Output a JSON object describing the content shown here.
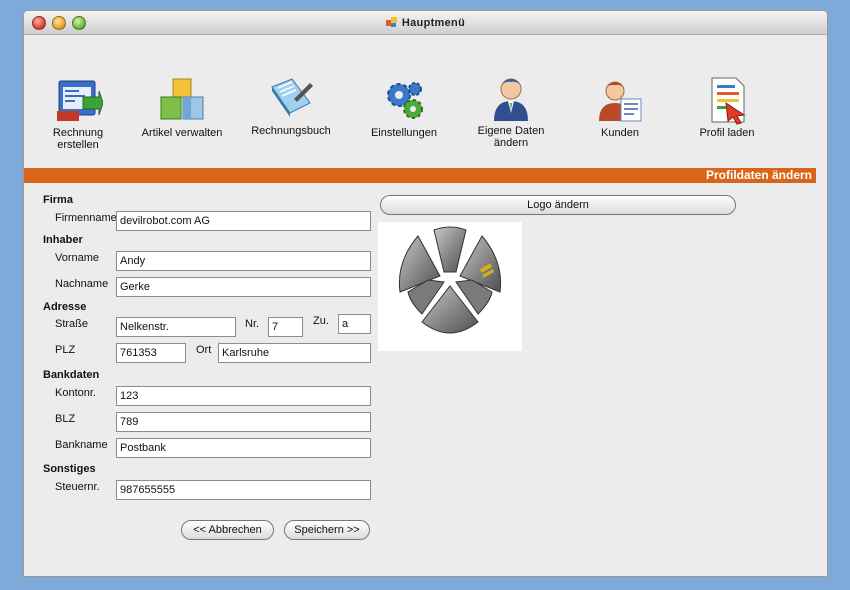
{
  "window": {
    "title": "Hauptmenü"
  },
  "toolbar": [
    {
      "label": "Rechnung\nerstellen",
      "icon": "invoice-create-icon"
    },
    {
      "label": "Artikel verwalten",
      "icon": "boxes-icon"
    },
    {
      "label": "Rechnungsbuch",
      "icon": "book-icon"
    },
    {
      "label": "Einstellungen",
      "icon": "gears-icon"
    },
    {
      "label": "Eigene Daten\nändern",
      "icon": "user-icon"
    },
    {
      "label": "Kunden",
      "icon": "customer-icon"
    },
    {
      "label": "Profil laden",
      "icon": "profile-document-icon"
    }
  ],
  "banner": {
    "title": "Profildaten ändern"
  },
  "colors": {
    "accent": "#d9651a",
    "background": "#7fa9d8",
    "window": "#ececec"
  },
  "form": {
    "firma": {
      "heading": "Firma",
      "firmenname_label": "Firmenname",
      "firmenname_value": "devilrobot.com AG"
    },
    "inhaber": {
      "heading": "Inhaber",
      "vorname_label": "Vorname",
      "vorname_value": "Andy",
      "nachname_label": "Nachname",
      "nachname_value": "Gerke"
    },
    "adresse": {
      "heading": "Adresse",
      "strasse_label": "Straße",
      "strasse_value": "Nelkenstr.",
      "nr_label": "Nr.",
      "nr_value": "7",
      "zu_label": "Zu.",
      "zu_value": "a",
      "plz_label": "PLZ",
      "plz_value": "761353",
      "ort_label": "Ort",
      "ort_value": "Karlsruhe"
    },
    "bankdaten": {
      "heading": "Bankdaten",
      "kontonr_label": "Kontonr.",
      "kontonr_value": "123",
      "blz_label": "BLZ",
      "blz_value": "789",
      "bankname_label": "Bankname",
      "bankname_value": "Postbank"
    },
    "sonstiges": {
      "heading": "Sonstiges",
      "steuernr_label": "Steuernr.",
      "steuernr_value": "987655555"
    }
  },
  "buttons": {
    "logo_aendern": "Logo ändern",
    "abbrechen": "<< Abbrechen",
    "speichern": "Speichern >>"
  }
}
